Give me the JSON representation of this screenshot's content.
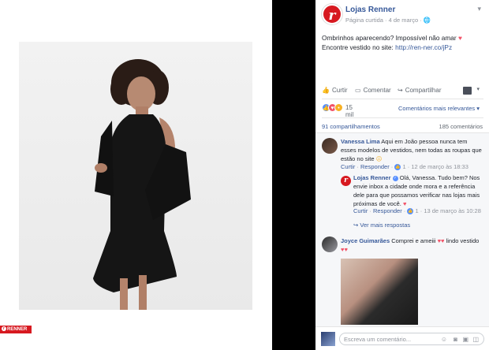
{
  "brand": {
    "accent": "#d71920",
    "link": "#365899"
  },
  "photo_panel": {
    "renner_tag": "RENNER"
  },
  "post": {
    "page_name": "Lojas Renner",
    "meta": "Página curtida · 4 de março ·",
    "text_line1": "Ombrinhos aparecendo? Impossível não amar",
    "text_line2_prefix": "Encontre vestido no site: ",
    "link": "http://ren-ner.co/jPz"
  },
  "actions": {
    "like": "Curtir",
    "comment": "Comentar",
    "share": "Compartilhar"
  },
  "stats": {
    "reactions": "15 mil",
    "comment_order": "Comentários mais relevantes",
    "shares": "91 compartilhamentos",
    "comments": "185 comentários"
  },
  "comments": [
    {
      "name": "Vanessa Lima",
      "text": "Aqui em João pessoa nunca tem esses modelos de vestidos, nem todas as roupas que estão no site",
      "like": "Curtir",
      "reply": "Responder",
      "likes": "1",
      "date": "12 de março às 18:33"
    },
    {
      "name": "Joyce Guimarães",
      "text": "Comprei e ameiii",
      "text_suffix": "lindo vestido"
    }
  ],
  "reply": {
    "name": "Lojas Renner",
    "text": "Olá, Vanessa. Tudo bem? Nos envie inbox a cidade onde mora e a referência dele para que possamos verificar nas lojas mais próximas de você.",
    "like": "Curtir",
    "reply": "Responder",
    "likes": "1",
    "date": "13 de março às 10:28",
    "more_replies": "Ver mais respostas"
  },
  "composer": {
    "placeholder": "Escreva um comentário..."
  }
}
